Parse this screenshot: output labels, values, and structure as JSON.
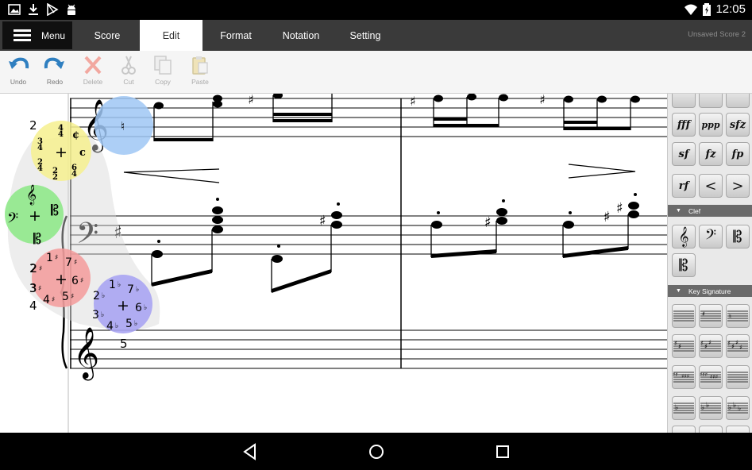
{
  "status_bar": {
    "time": "12:05",
    "left_icons": [
      "image-icon",
      "download-icon",
      "play-store-icon",
      "android-icon"
    ],
    "right_icons": [
      "wifi-icon",
      "battery-icon"
    ]
  },
  "tabs": {
    "menu_label": "Menu",
    "items": [
      {
        "label": "Score",
        "active": false
      },
      {
        "label": "Edit",
        "active": true
      },
      {
        "label": "Format",
        "active": false
      },
      {
        "label": "Notation",
        "active": false
      },
      {
        "label": "Setting",
        "active": false
      }
    ],
    "document_title": "Unsaved Score 2"
  },
  "toolbar": {
    "undo": "Undo",
    "redo": "Redo",
    "delete": "Delete",
    "cut": "Cut",
    "copy": "Copy",
    "paste": "Paste"
  },
  "palette": {
    "dynamics": [
      "fff",
      "ppp",
      "sfz",
      "sf",
      "fz",
      "fp",
      "rf",
      "<",
      ">"
    ],
    "clef_header": "Clef",
    "key_header": "Key Signature"
  },
  "overlay": {
    "time_numbers": [
      "2",
      "3",
      "4",
      "5"
    ],
    "sharp_degrees": [
      "1",
      "2",
      "3",
      "4",
      "5",
      "6",
      "7"
    ],
    "flat_degrees": [
      "1",
      "2",
      "3",
      "4",
      "5",
      "6",
      "7"
    ],
    "meter_top": [
      "4",
      "3"
    ],
    "meter_bottom": [
      "4",
      "4"
    ],
    "meter_symbols": [
      "¢",
      "c"
    ],
    "meter_other": [
      "2",
      "6"
    ],
    "plus": "+"
  },
  "colors": {
    "status_bar": "#000000",
    "tab_bar": "#3a3a3a",
    "palette_header": "#6a6a6a",
    "time_wheel": "#f6f08e",
    "clef_wheel": "#8fe88a",
    "sharp_wheel": "#f39a9a",
    "flat_wheel": "#a8a4f2",
    "natural_wheel": "#9fc7f4"
  }
}
